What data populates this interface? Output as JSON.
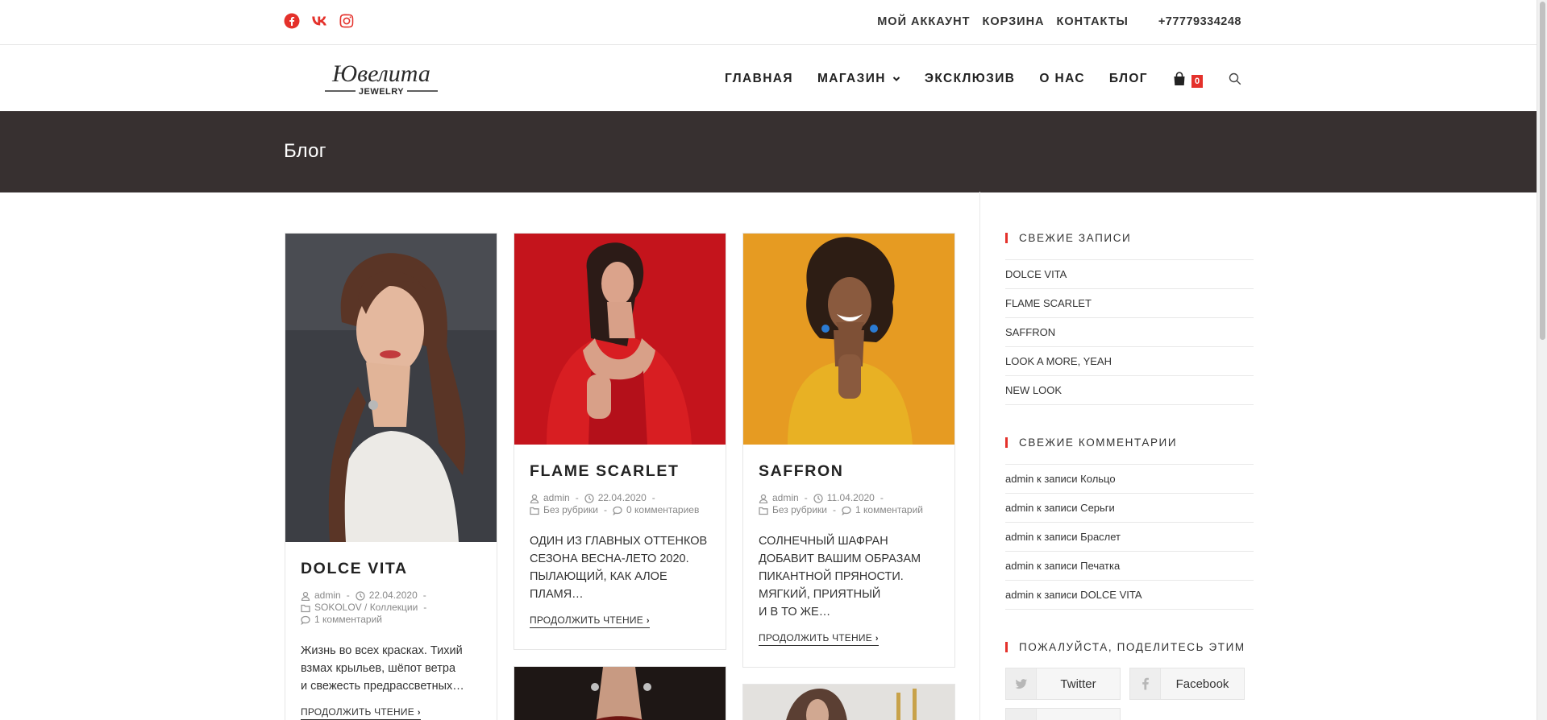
{
  "topbar": {
    "social": [
      "facebook-icon",
      "vk-icon",
      "instagram-icon"
    ],
    "menu": [
      "МОЙ АККАУНТ",
      "КОРЗИНА",
      "КОНТАКТЫ"
    ],
    "phone": "+77779334248"
  },
  "header": {
    "logo_text": "Ювелита",
    "logo_sub": "JEWELRY",
    "nav": [
      "ГЛАВНАЯ",
      "МАГАЗИН",
      "ЭКСКЛЮЗИВ",
      "О НАС",
      "БЛОГ"
    ],
    "cart_count": "0"
  },
  "page_title": "Блог",
  "posts": [
    {
      "title": "DOLCE VITA",
      "author": "admin",
      "date": "22.04.2020",
      "category": "SOKOLOV / Коллекции",
      "comments": "1 комментарий",
      "excerpt": [
        "Жизнь во всех красках. Тихий",
        "взмах крыльев, шёпот ветра",
        "и свежесть предрассветных…"
      ],
      "read_more": "ПРОДОЛЖИТЬ ЧТЕНИЕ"
    },
    {
      "title": "FLAME SCARLET",
      "author": "admin",
      "date": "22.04.2020",
      "category": "Без рубрики",
      "comments": "0 комментариев",
      "excerpt": [
        "ОДИН ИЗ ГЛАВНЫХ ОТТЕНКОВ",
        "СЕЗОНА ВЕСНА-ЛЕТО 2020.",
        "ПЫЛАЮЩИЙ, КАК АЛОЕ",
        "ПЛАМЯ…"
      ],
      "read_more": "ПРОДОЛЖИТЬ ЧТЕНИЕ"
    },
    {
      "title": "SAFFRON",
      "author": "admin",
      "date": "11.04.2020",
      "category": "Без рубрики",
      "comments": "1 комментарий",
      "excerpt": [
        "СОЛНЕЧНЫЙ ШАФРАН",
        "ДОБАВИТ ВАШИМ ОБРАЗАМ",
        "ПИКАНТНОЙ ПРЯНОСТИ.",
        "МЯГКИЙ, ПРИЯТНЫЙ",
        "И В ТО ЖЕ…"
      ],
      "read_more": "ПРОДОЛЖИТЬ ЧТЕНИЕ"
    }
  ],
  "sidebar": {
    "recent_posts_title": "СВЕЖИЕ ЗАПИСИ",
    "recent_posts": [
      "DOLCE VITA",
      "FLAME SCARLET",
      "SAFFRON",
      "LOOK A MORE, YEAH",
      "NEW LOOK"
    ],
    "recent_comments_title": "СВЕЖИЕ КОММЕНТАРИИ",
    "recent_comments": [
      "admin к записи Кольцо",
      "admin к записи Серьги",
      "admin к записи Браслет",
      "admin к записи Печатка",
      "admin к записи DOLCE VITA"
    ],
    "share_title": "ПОЖАЛУЙСТА, ПОДЕЛИТЕСЬ ЭТИМ",
    "share_buttons": [
      "Twitter",
      "Facebook"
    ]
  },
  "colors": {
    "accent": "#e4312b",
    "title_band": "#373030"
  }
}
